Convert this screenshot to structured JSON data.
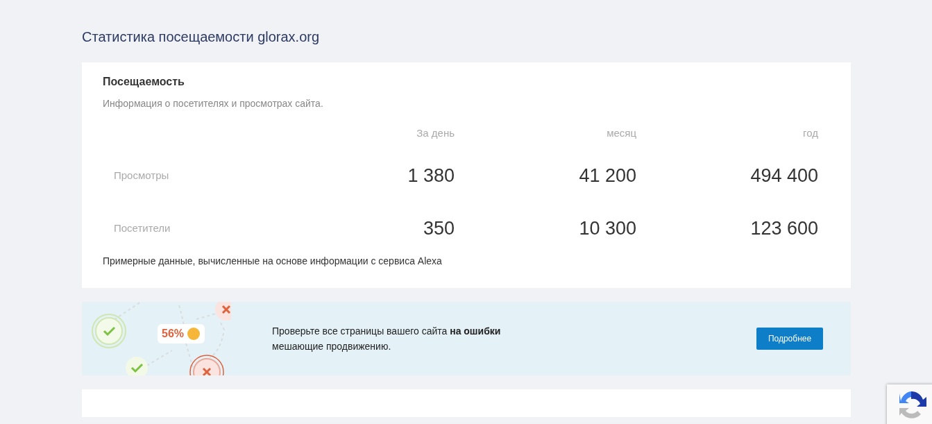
{
  "page_title": "Статистика посещаемости glorax.org",
  "traffic": {
    "heading": "Посещаемость",
    "description": "Информация о посетителях и просмотрах сайта.",
    "columns": [
      "За день",
      "месяц",
      "год"
    ],
    "rows": [
      {
        "label": "Просмотры",
        "values": [
          "1 380",
          "41 200",
          "494 400"
        ]
      },
      {
        "label": "Посетители",
        "values": [
          "350",
          "10 300",
          "123 600"
        ]
      }
    ],
    "note": "Примерные данные, вычисленные на основе информации с сервиса Alexa"
  },
  "banner": {
    "score": "56%",
    "text": "Проверьте все страницы вашего сайта **на ошибки** мешающие продвижению.",
    "button": "Подробнее"
  }
}
